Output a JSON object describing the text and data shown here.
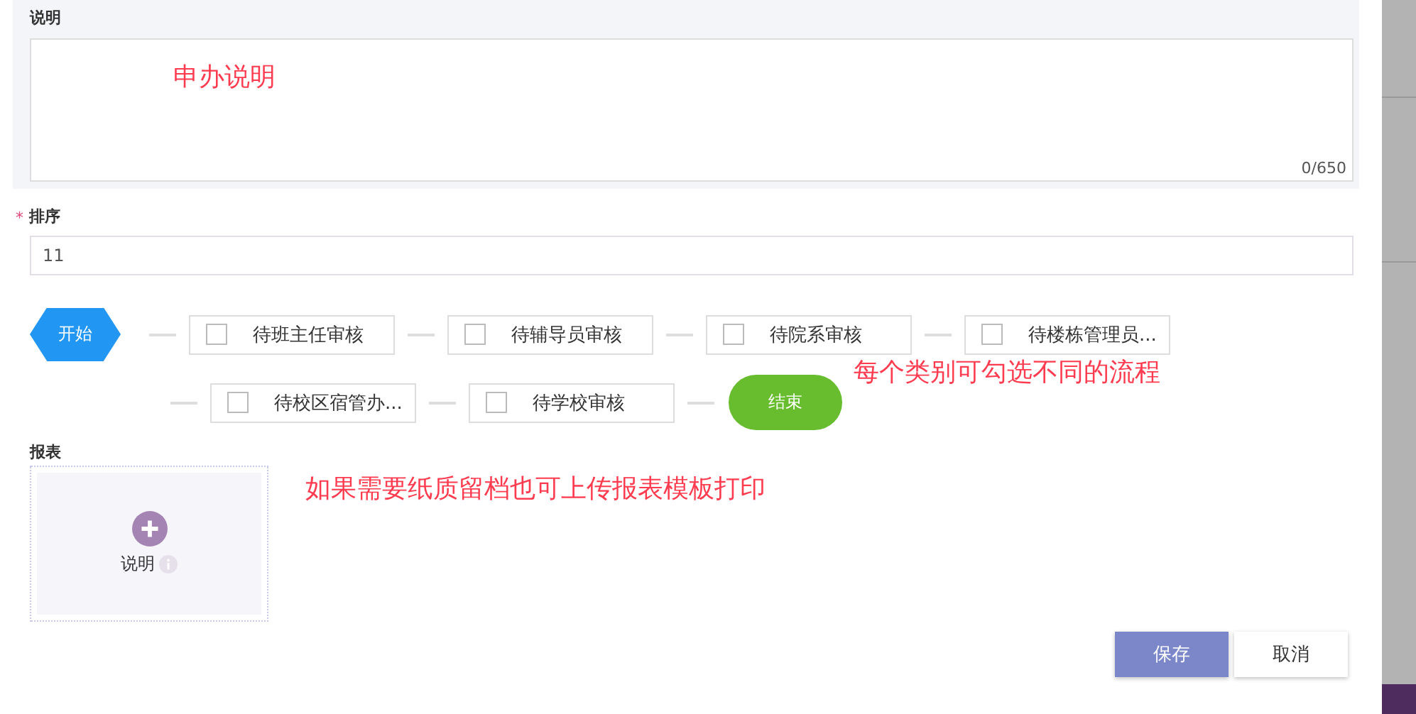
{
  "description": {
    "label": "说明",
    "counter": "0/650",
    "annotation": "申办说明"
  },
  "order": {
    "label": "排序",
    "required_mark": "*",
    "value": "11"
  },
  "flow": {
    "nodes": [
      {
        "kind": "start",
        "label": "开始"
      },
      {
        "kind": "step",
        "label": "待班主任审核",
        "checked": false
      },
      {
        "kind": "step",
        "label": "待辅导员审核",
        "checked": false
      },
      {
        "kind": "step",
        "label": "待院系审核",
        "checked": false
      },
      {
        "kind": "step",
        "label": "待楼栋管理员...",
        "checked": false
      },
      {
        "kind": "step",
        "label": "待校区宿管办...",
        "checked": false
      },
      {
        "kind": "step",
        "label": "待学校审核",
        "checked": false
      },
      {
        "kind": "end",
        "label": "结束"
      }
    ],
    "annotation": "每个类别可勾选不同的流程"
  },
  "report": {
    "label": "报表",
    "upload_label": "说明",
    "annotation": "如果需要纸质留档也可上传报表模板打印"
  },
  "buttons": [
    {
      "kind": "primary",
      "label": "保存"
    },
    {
      "kind": "default",
      "label": "取消"
    }
  ]
}
